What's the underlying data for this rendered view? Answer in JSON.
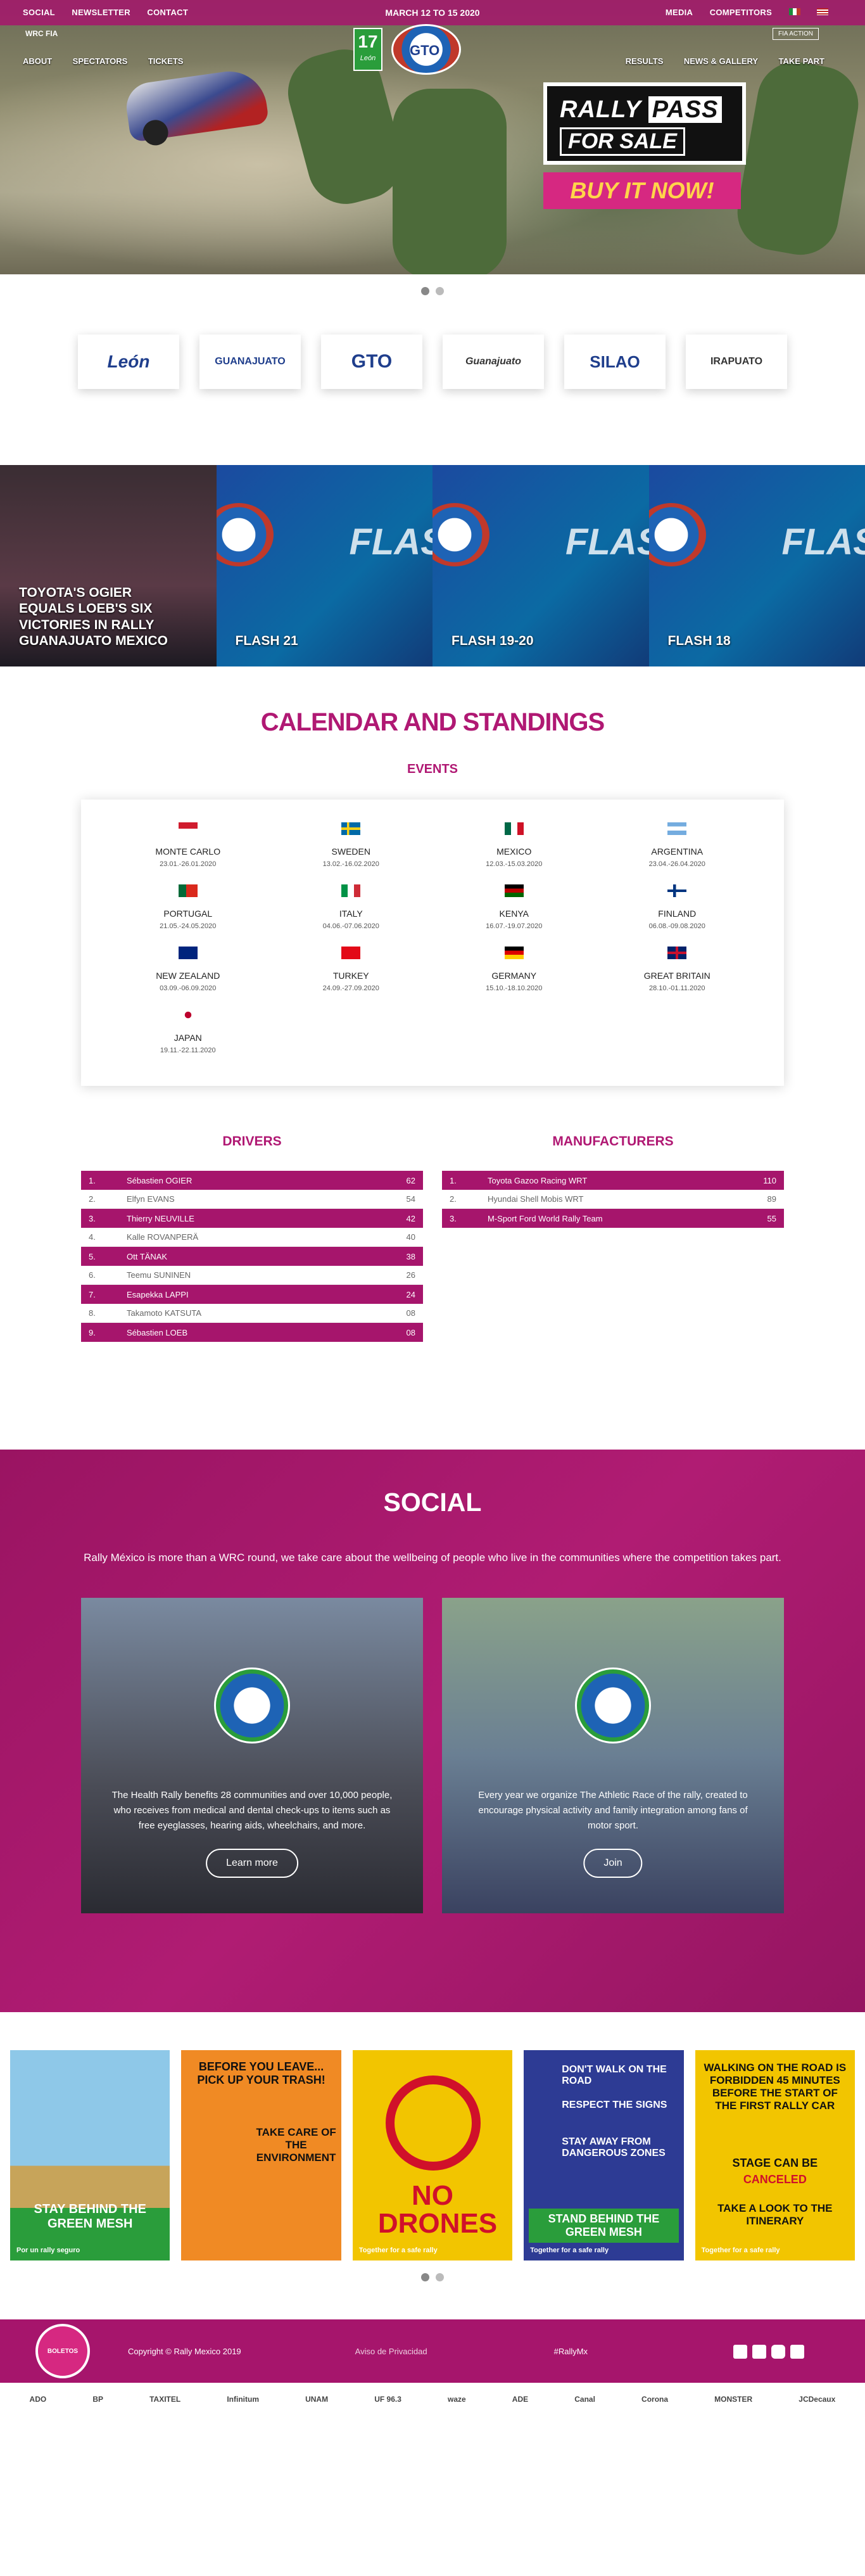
{
  "topbar": {
    "left": [
      "SOCIAL",
      "NEWSLETTER",
      "CONTACT"
    ],
    "date": "MARCH 12 TO 15 2020",
    "right": [
      "MEDIA",
      "COMPETITORS"
    ]
  },
  "secbar": {
    "left": [
      "ABOUT",
      "SPECTATORS",
      "TICKETS"
    ],
    "right": [
      "RESULTS",
      "NEWS & GALLERY",
      "TAKE PART"
    ]
  },
  "brand": {
    "wrc": "WRC",
    "fia": "FIA",
    "num": "17",
    "num_sub": "León",
    "gto": "GTO",
    "fia_badge": "FIA ACTION"
  },
  "hero": {
    "pass1": "RALLY",
    "pass2": "PASS",
    "pass3": "FOR SALE",
    "buy": "BUY IT NOW!"
  },
  "sponsors": [
    "León",
    "GUANAJUATO",
    "GTO",
    "Guanajuato",
    "SILAO",
    "IRAPUATO"
  ],
  "flash": [
    {
      "cap": "TOYOTA'S OGIER EQUALS LOEB'S SIX VICTORIES IN RALLY GUANAJUATO MEXICO"
    },
    {
      "cap": "FLASH 21",
      "word": "FLAS"
    },
    {
      "cap": "FLASH 19-20",
      "word": "FLAS"
    },
    {
      "cap": "FLASH 18",
      "word": "FLAS"
    }
  ],
  "calendar_title": "CALENDAR AND STANDINGS",
  "events_title": "EVENTS",
  "events": [
    {
      "name": "MONTE CARLO",
      "dates": "23.01.-26.01.2020"
    },
    {
      "name": "SWEDEN",
      "dates": "13.02.-16.02.2020"
    },
    {
      "name": "MEXICO",
      "dates": "12.03.-15.03.2020"
    },
    {
      "name": "ARGENTINA",
      "dates": "23.04.-26.04.2020"
    },
    {
      "name": "PORTUGAL",
      "dates": "21.05.-24.05.2020"
    },
    {
      "name": "ITALY",
      "dates": "04.06.-07.06.2020"
    },
    {
      "name": "KENYA",
      "dates": "16.07.-19.07.2020"
    },
    {
      "name": "FINLAND",
      "dates": "06.08.-09.08.2020"
    },
    {
      "name": "NEW ZEALAND",
      "dates": "03.09.-06.09.2020"
    },
    {
      "name": "TURKEY",
      "dates": "24.09.-27.09.2020"
    },
    {
      "name": "GERMANY",
      "dates": "15.10.-18.10.2020"
    },
    {
      "name": "GREAT BRITAIN",
      "dates": "28.10.-01.11.2020"
    },
    {
      "name": "JAPAN",
      "dates": "19.11.-22.11.2020"
    }
  ],
  "drivers_title": "DRIVERS",
  "drivers": [
    [
      "1.",
      "Sébastien OGIER",
      "62"
    ],
    [
      "2.",
      "Elfyn EVANS",
      "54"
    ],
    [
      "3.",
      "Thierry NEUVILLE",
      "42"
    ],
    [
      "4.",
      "Kalle ROVANPERÄ",
      "40"
    ],
    [
      "5.",
      "Ott TÄNAK",
      "38"
    ],
    [
      "6.",
      "Teemu SUNINEN",
      "26"
    ],
    [
      "7.",
      "Esapekka LAPPI",
      "24"
    ],
    [
      "8.",
      "Takamoto KATSUTA",
      "08"
    ],
    [
      "9.",
      "Sébastien LOEB",
      "08"
    ]
  ],
  "manufacturers_title": "MANUFACTURERS",
  "manufacturers": [
    [
      "1.",
      "Toyota Gazoo Racing WRT",
      "110"
    ],
    [
      "2.",
      "Hyundai Shell Mobis WRT",
      "89"
    ],
    [
      "3.",
      "M-Sport Ford World Rally Team",
      "55"
    ]
  ],
  "social": {
    "title": "SOCIAL",
    "intro": "Rally México is more than a WRC round, we take care about the wellbeing of people who live in the communities where the competition takes part.",
    "card1": {
      "text": "The Health Rally benefits 28 communities and over 10,000 people, who receives from medical and dental check-ups to items such as free eyeglasses, hearing aids, wheelchairs, and more.",
      "btn": "Learn more",
      "emb": "Rally"
    },
    "card2": {
      "text": "Every year we organize The Athletic Race of the rally, created to encourage physical activity and family integration among fans of motor sport.",
      "btn": "Join",
      "emb": "6"
    }
  },
  "posters": [
    {
      "a": "STAY BEHIND THE GREEN MESH",
      "foot": "Por un rally seguro"
    },
    {
      "a": "BEFORE YOU LEAVE... PICK UP YOUR TRASH!",
      "b": "TAKE CARE OF THE ENVIRONMENT"
    },
    {
      "a": "NO DRONES",
      "foot": "Together for a safe rally"
    },
    {
      "a": "DON'T WALK ON THE ROAD",
      "b": "RESPECT THE SIGNS",
      "c": "STAY AWAY FROM DANGEROUS ZONES",
      "d": "STAND BEHIND THE GREEN MESH",
      "foot": "Together for a safe rally"
    },
    {
      "a": "WALKING ON THE ROAD IS FORBIDDEN 45 MINUTES BEFORE THE START OF THE FIRST RALLY CAR",
      "b": "STAGE CAN BE",
      "b2": "CANCELED",
      "c": "TAKE A LOOK TO THE ITINERARY",
      "foot": "Together for a safe rally"
    }
  ],
  "footer": {
    "boletos": "BOLETOS",
    "copy": "Copyright © Rally Mexico 2019",
    "privacy": "Aviso de Privacidad",
    "tag": "#RallyMx"
  },
  "logos": [
    "ADO",
    "BP",
    "TAXITEL",
    "Infinitum",
    "UNAM",
    "UF 96.3",
    "waze",
    "ADE",
    "Canal",
    "Corona",
    "MONSTER",
    "JCDecaux"
  ],
  "colors": {
    "brand": "#a6156c",
    "accent": "#d62881"
  }
}
